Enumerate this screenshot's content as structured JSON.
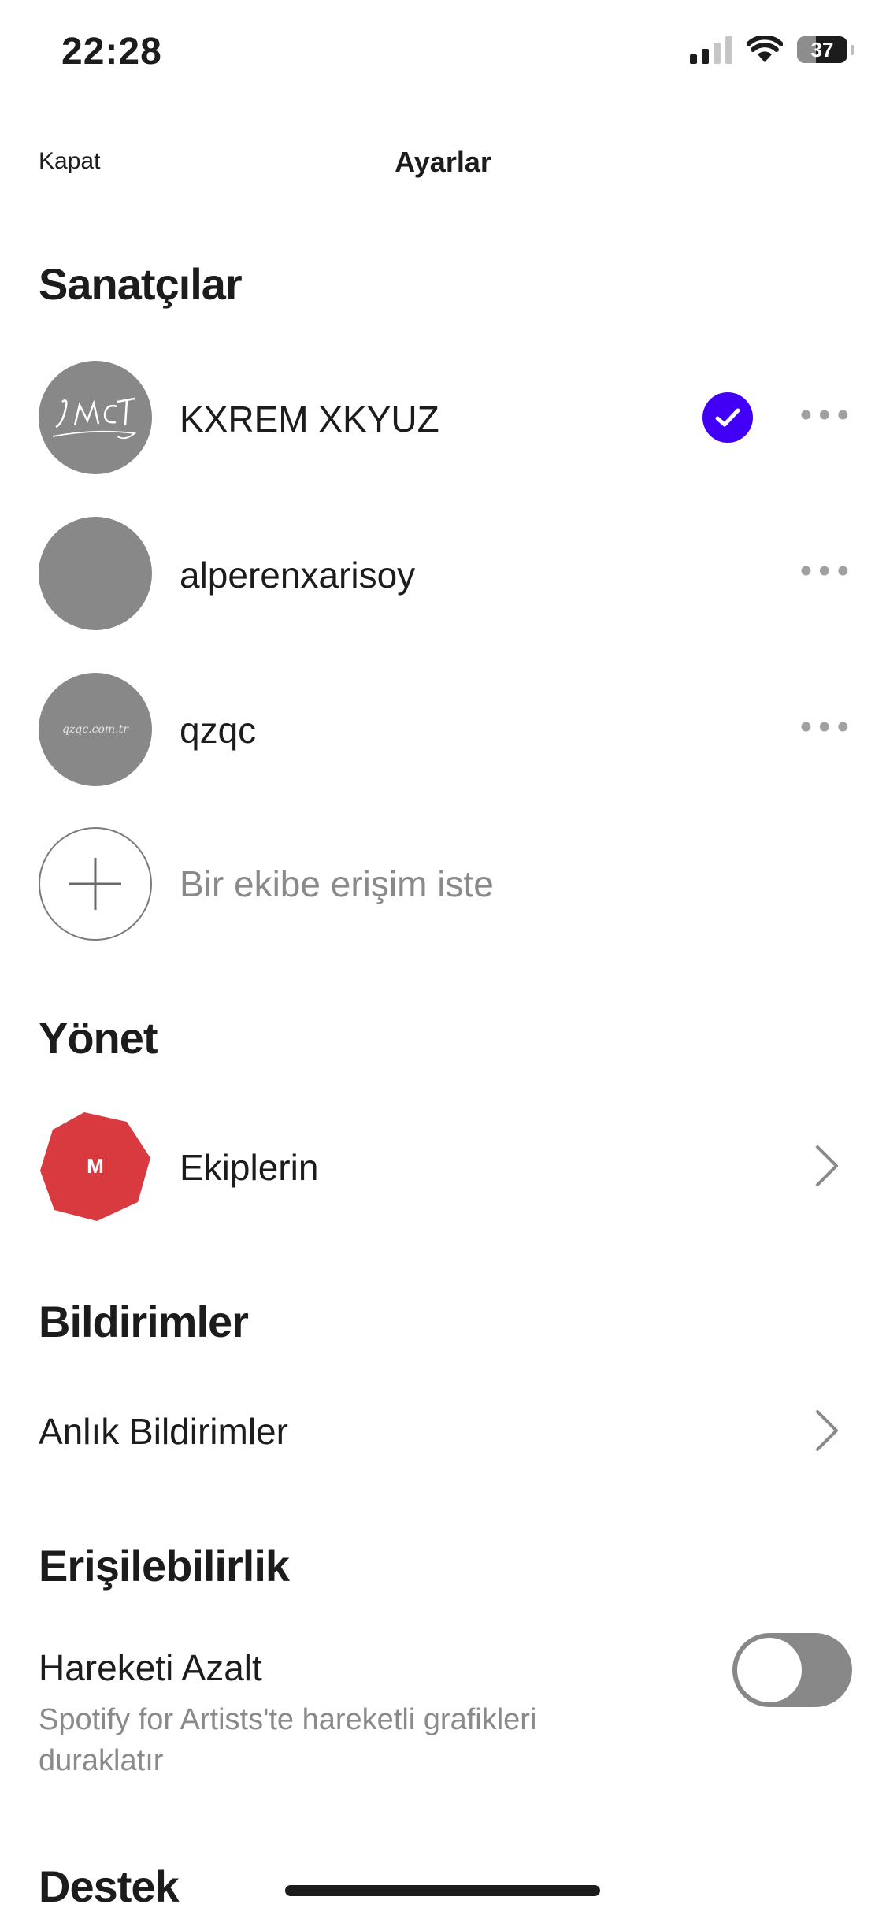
{
  "status_bar": {
    "time": "22:28",
    "battery": "37",
    "battery_level": 0.37,
    "signal_bars": 2
  },
  "nav": {
    "close_label": "Kapat",
    "title": "Ayarlar"
  },
  "artists": {
    "title": "Sanatçılar",
    "items": [
      {
        "name": "KXREM XKYUZ",
        "selected": true,
        "avatar_text": "MCT"
      },
      {
        "name": "alperenxarisoy",
        "selected": false,
        "avatar_text": ""
      },
      {
        "name": "qzqc",
        "selected": false,
        "avatar_text": "qzqc.com.tr"
      }
    ],
    "add_label": "Bir ekibe erişim iste"
  },
  "manage": {
    "title": "Yönet",
    "teams": {
      "initial": "M",
      "label": "Ekiplerin",
      "avatar_color": "#d93a3f"
    }
  },
  "notifications": {
    "title": "Bildirimler",
    "push_label": "Anlık Bildirimler"
  },
  "accessibility": {
    "title": "Erişilebilirlik",
    "reduce_motion_label": "Hareketi Azalt",
    "reduce_motion_desc": "Spotify for Artists'te hareketli grafikleri duraklatır",
    "reduce_motion_on": false
  },
  "support": {
    "title": "Destek"
  },
  "colors": {
    "accent": "#4100f5",
    "toggle_off": "#888888",
    "team_red": "#d93a3f"
  }
}
